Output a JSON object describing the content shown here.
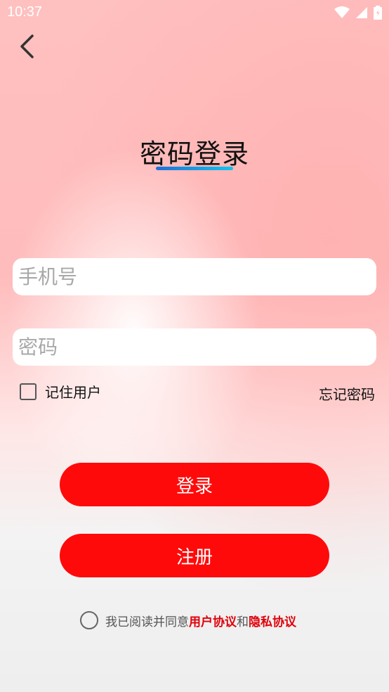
{
  "status": {
    "time": "10:37"
  },
  "header": {
    "title": "密码登录"
  },
  "form": {
    "phone_placeholder": "手机号",
    "password_placeholder": "密码",
    "remember_label": "记住用户",
    "forgot_label": "忘记密码"
  },
  "buttons": {
    "login": "登录",
    "register": "注册"
  },
  "agreement": {
    "prefix": "我已阅读并同意",
    "user_agreement": "用户协议",
    "and": "和",
    "privacy_policy": "隐私协议"
  },
  "colors": {
    "accent": "#ff0a0a",
    "underline_start": "#1d6fd6",
    "underline_end": "#12c5f0"
  }
}
